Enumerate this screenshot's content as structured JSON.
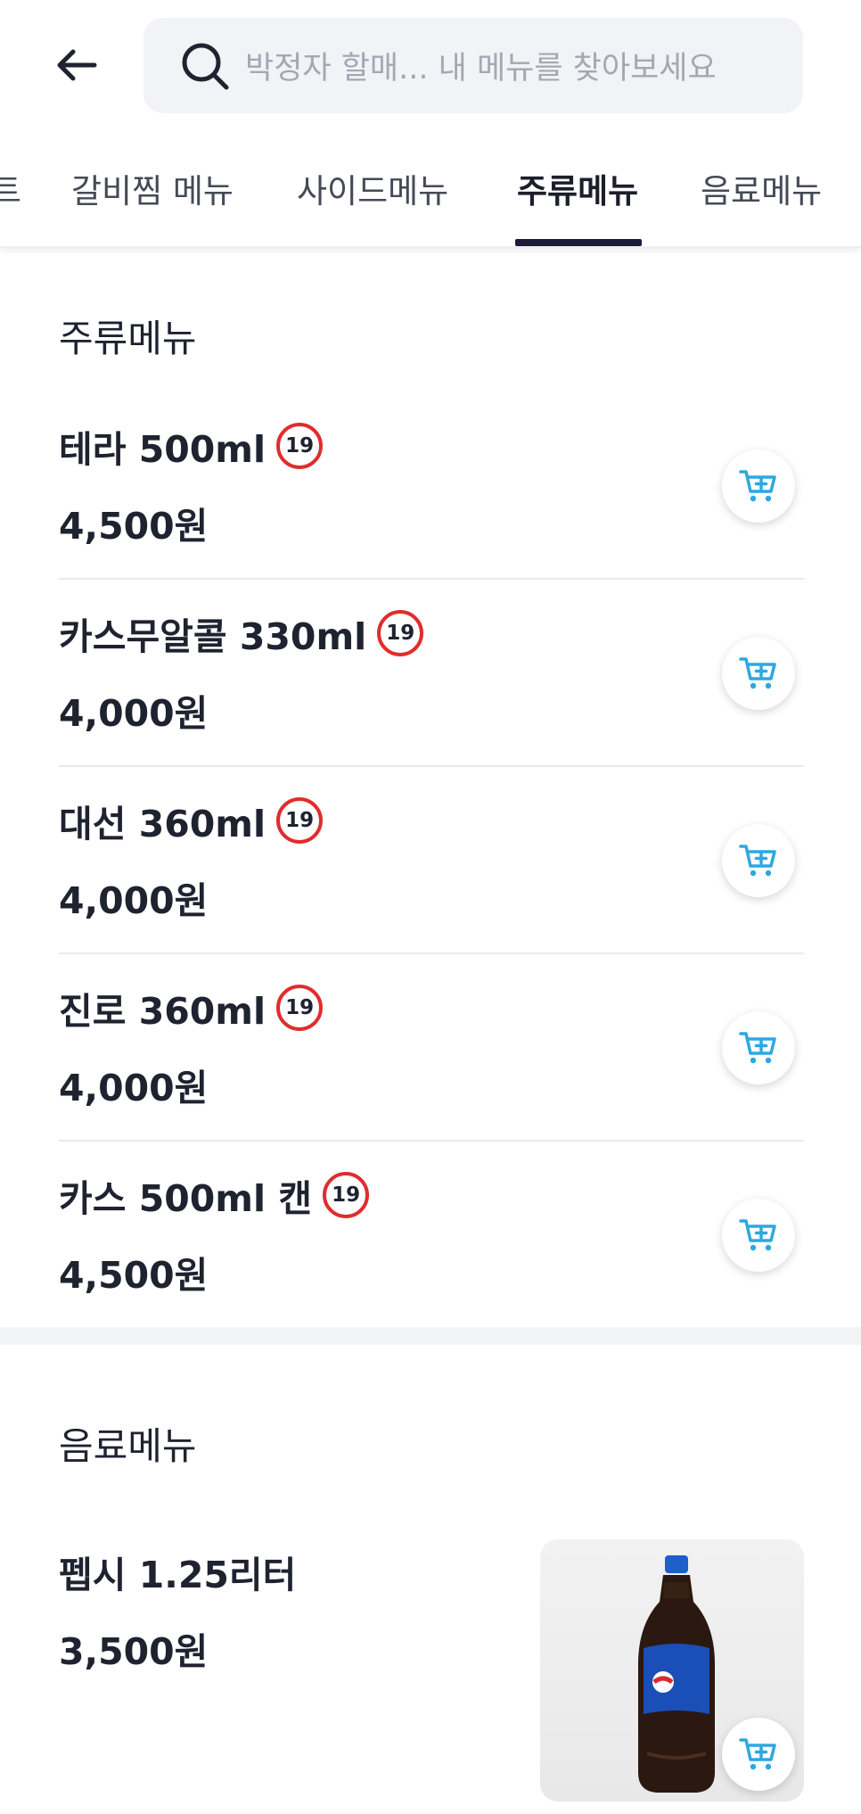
{
  "header": {
    "search_placeholder": "박정자 할매... 내 메뉴를 찾아보세요"
  },
  "tabs": [
    {
      "label": "트"
    },
    {
      "label": "갈비찜 메뉴"
    },
    {
      "label": "사이드메뉴"
    },
    {
      "label": "주류메뉴",
      "active": true
    },
    {
      "label": "음료메뉴"
    }
  ],
  "sections": {
    "liquor": {
      "title": "주류메뉴",
      "items": [
        {
          "name": "테라 500ml",
          "badge": "19",
          "price": "4,500원"
        },
        {
          "name": "카스무알콜 330ml",
          "badge": "19",
          "price": "4,000원"
        },
        {
          "name": "대선 360ml",
          "badge": "19",
          "price": "4,000원"
        },
        {
          "name": "진로 360ml",
          "badge": "19",
          "price": "4,000원"
        },
        {
          "name": "카스 500ml 캔",
          "badge": "19",
          "price": "4,500원"
        }
      ]
    },
    "drinks": {
      "title": "음료메뉴",
      "items": [
        {
          "name": "펩시 1.25리터",
          "price": "3,500원"
        }
      ]
    }
  },
  "colors": {
    "accent": "#2ea8e0",
    "age_badge": "#e02d2d",
    "tab_indicator": "#1c1a3a"
  },
  "icons": {
    "back": "arrow-left-icon",
    "search": "search-icon",
    "cart": "cart-plus-icon"
  }
}
